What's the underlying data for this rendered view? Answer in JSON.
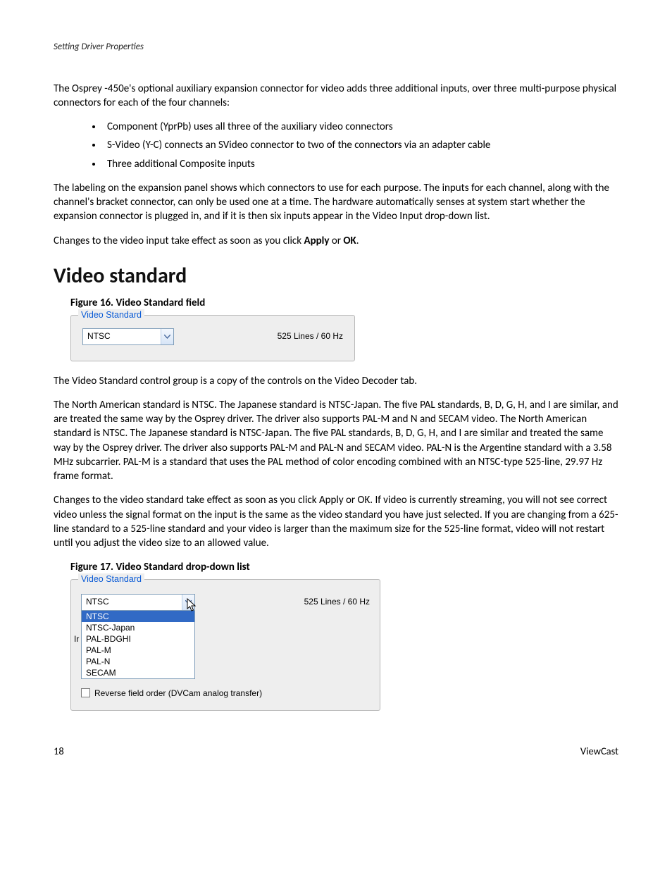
{
  "header": {
    "section_title": "Setting Driver Properties"
  },
  "body": {
    "p1": "The Osprey -450e's optional auxiliary expansion connector for video adds three additional inputs, over three multi-purpose physical connectors for each of the four channels:",
    "bullets": [
      "Component (YprPb) uses all three of the auxiliary video connectors",
      "S-Video (Y-C) connects an SVideo connector to two of the connectors via an adapter cable",
      "Three additional Composite inputs"
    ],
    "p2": "The labeling on the expansion panel shows which connectors to use for each purpose. The inputs for each channel, along with the channel's bracket connector, can only be used one at a time. The hardware automatically senses at system start whether the expansion connector is plugged in, and if it is then six inputs appear in the Video Input drop-down list.",
    "p3_pre": "Changes to the video input take effect as soon as you click ",
    "p3_b1": "Apply",
    "p3_mid": " or ",
    "p3_b2": "OK",
    "p3_post": ".",
    "heading": "Video standard",
    "fig16_caption": "Figure 16. Video Standard field",
    "p4": "The Video Standard control group is a copy of the controls on the Video Decoder tab.",
    "p5": "The North American standard is NTSC. The Japanese standard is NTSC-Japan. The five PAL standards, B, D, G, H, and I are similar, and are treated the same way by the Osprey driver. The driver also supports PAL-M and N and SECAM video. The North American standard is NTSC. The Japanese standard is NTSC-Japan. The five PAL standards, B, D, G, H, and I are similar and treated the same way by the Osprey driver. The driver also supports PAL-M and PAL-N and SECAM video. PAL-N is the Argentine standard with a 3.58 MHz subcarrier. PAL-M is a standard that uses the PAL method of color encoding combined with an NTSC-type 525-line, 29.97 Hz frame format.",
    "p6": "Changes to the video standard take effect as soon as you click Apply or OK. If video is currently streaming, you will not see correct video unless the signal format on the input is the same as the video standard you have just selected. If you are changing from a 625-line standard to a 525-line standard and your video is larger than the maximum size for the 525-line format, video will not restart until you adjust the video size to an allowed value.",
    "fig17_caption": "Figure 17. Video Standard drop-down list"
  },
  "fig16": {
    "legend": "Video Standard",
    "dropdown_value": "NTSC",
    "lines_label": "525 Lines / 60 Hz"
  },
  "fig17": {
    "legend": "Video Standard",
    "dropdown_value": "NTSC",
    "lines_label": "525 Lines / 60 Hz",
    "options": [
      "NTSC",
      "NTSC-Japan",
      "PAL-BDGHI",
      "PAL-M",
      "PAL-N",
      "SECAM"
    ],
    "selected_index": 0,
    "left_cut_text": "Ir",
    "checkbox_label": "Reverse field order (DVCam analog transfer)"
  },
  "footer": {
    "page": "18",
    "brand": "ViewCast"
  }
}
